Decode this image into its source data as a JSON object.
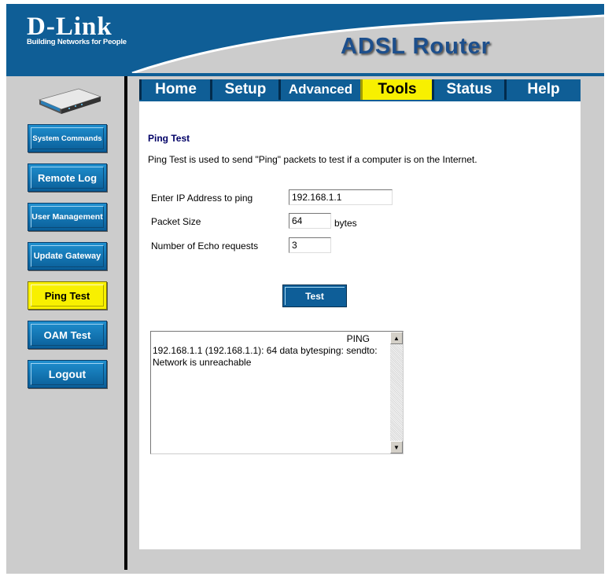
{
  "brand": {
    "name": "D-Link",
    "tagline": "Building Networks for People"
  },
  "product": "ADSL Router",
  "tabs": [
    {
      "label": "Home",
      "active": false
    },
    {
      "label": "Setup",
      "active": false
    },
    {
      "label": "Advanced",
      "active": false
    },
    {
      "label": "Tools",
      "active": true
    },
    {
      "label": "Status",
      "active": false
    },
    {
      "label": "Help",
      "active": false
    }
  ],
  "sidebar": [
    {
      "label": "System Commands",
      "active": false
    },
    {
      "label": "Remote Log",
      "active": false
    },
    {
      "label": "User Management",
      "active": false
    },
    {
      "label": "Update Gateway",
      "active": false
    },
    {
      "label": "Ping Test",
      "active": true
    },
    {
      "label": "OAM Test",
      "active": false
    },
    {
      "label": "Logout",
      "active": false
    }
  ],
  "ping": {
    "title": "Ping Test",
    "description": "Ping Test is used to send \"Ping\" packets to test if a computer is on the Internet.",
    "ip_label": "Enter IP Address to ping",
    "ip_value": "192.168.1.1",
    "size_label": "Packet Size",
    "size_value": "64",
    "size_unit": "bytes",
    "count_label": "Number of Echo requests",
    "count_value": "3",
    "test_button": "Test",
    "output_first_line": "PING",
    "output": "192.168.1.1 (192.168.1.1): 64 data bytesping: sendto: Network is unreachable"
  },
  "colors": {
    "header_blue": "#0f5e96",
    "tab_active": "#f8f000",
    "sidebar_button": "#0a6aa8",
    "panel_gray": "#cccccc"
  }
}
